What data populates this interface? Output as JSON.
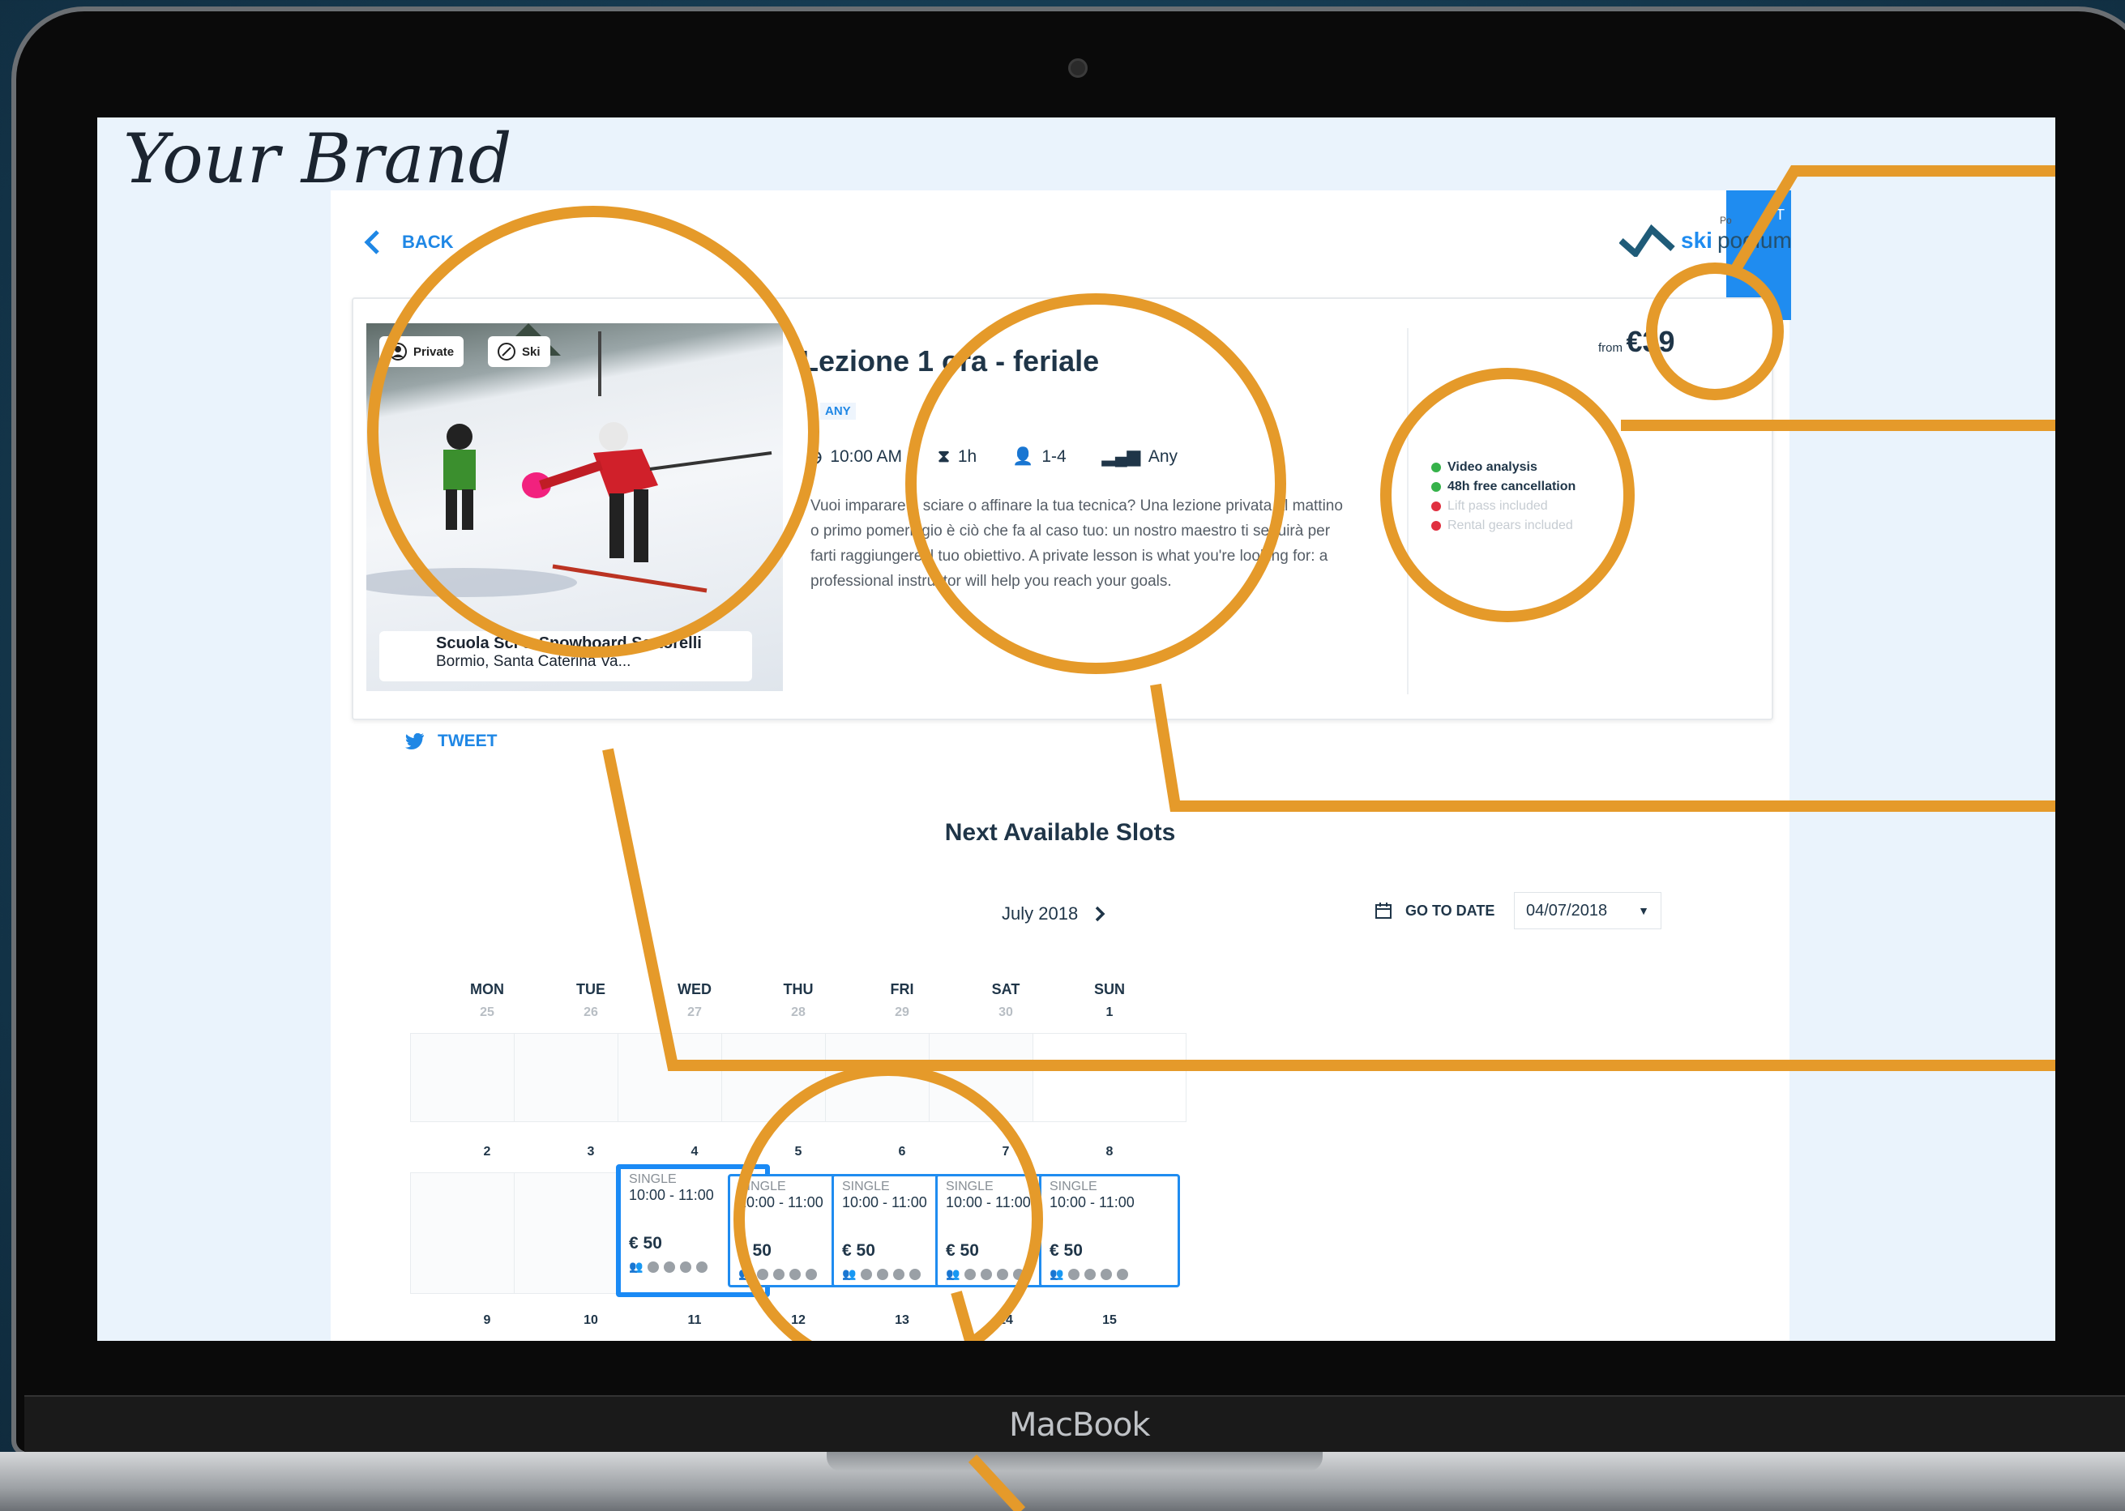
{
  "brand": "Your Brand",
  "device_label": "MacBook",
  "nav": {
    "back_label": "BACK"
  },
  "logo": {
    "ski": "ski",
    "podium": "podium",
    "powered": "Po",
    "tag": "1 T"
  },
  "lesson": {
    "title": "Lezione 1 ora - feriale",
    "level_badge": "ANY",
    "time": "10:00 AM",
    "duration": "1h",
    "group_size": "1-4",
    "skill": "Any",
    "description": "Vuoi imparare a sciare o affinare la tua tecnica? Una lezione privata al mattino o primo pomeriggio è ciò che fa al caso tuo: un nostro maestro ti seguirà per farti raggiungere il tuo obiettivo. A private lesson is what you're looking for: a professional instructor will help you reach your goals.",
    "tags": {
      "private": "Private",
      "sport": "Ski"
    },
    "school_name": "Scuola Sci & Snowboard Sertorelli",
    "school_location": "Bormio, Santa Caterina Va..."
  },
  "features": [
    {
      "label": "Video analysis",
      "included": true
    },
    {
      "label": "48h free cancellation",
      "included": true
    },
    {
      "label": "Lift pass included",
      "included": false
    },
    {
      "label": "Rental gears included",
      "included": false
    }
  ],
  "price": {
    "from_label": "from",
    "value": "€39"
  },
  "share": {
    "tweet_label": "TWEET"
  },
  "calendar": {
    "title": "Next Available Slots",
    "month_label": "July 2018",
    "goto_label": "GO TO DATE",
    "date_value": "04/07/2018",
    "weekdays": [
      "MON",
      "TUE",
      "WED",
      "THU",
      "FRI",
      "SAT",
      "SUN"
    ],
    "week1": [
      "25",
      "26",
      "27",
      "28",
      "29",
      "30",
      "1"
    ],
    "week2": [
      "2",
      "3",
      "4",
      "5",
      "6",
      "7",
      "8"
    ],
    "week3": [
      "9",
      "10",
      "11",
      "12",
      "13",
      "14",
      "15"
    ],
    "slot_type": "SINGLE",
    "slot_time": "10:00 - 11:00",
    "slot_price": "€ 50"
  },
  "colors": {
    "accent": "#1f8cf0",
    "annotation": "#e59a2a",
    "text": "#1f3548"
  }
}
